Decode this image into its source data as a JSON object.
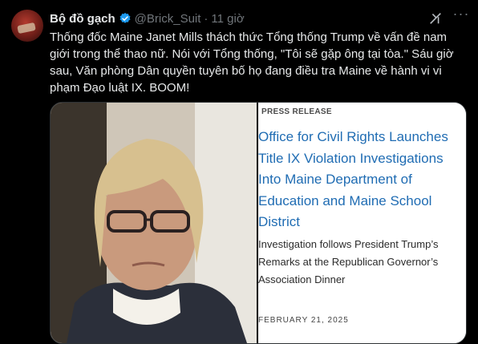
{
  "tweet": {
    "display_name": "Bộ đồ gạch",
    "handle": "@Brick_Suit",
    "separator": "·",
    "time": "11 giờ",
    "verified_icon": "verified-badge-icon",
    "grok_icon": "grok-icon",
    "more_icon": "more-options-icon",
    "more_glyph": "···",
    "text": "Thống đốc Maine Janet Mills thách thức Tổng thống Trump về vấn đề nam giới trong thể thao nữ. Nói với Tổng thống, \"Tôi sẽ gặp ông tại tòa.\" Sáu giờ sau, Văn phòng Dân quyền tuyên bố họ đang điều tra Maine về hành vi vi phạm Đạo luật IX. BOOM!"
  },
  "media": {
    "press_release": {
      "label": "PRESS RELEASE",
      "title": "Office for Civil Rights Launches\nTitle IX Violation Investigations\nInto Maine Department of\nEducation and Maine School\nDistrict",
      "body": "Investigation follows President Trump’s\nRemarks at the Republican Governor’s\nAssociation Dinner",
      "date": "FEBRUARY 21, 2025"
    }
  },
  "colors": {
    "background": "#000000",
    "text": "#e7e9ea",
    "secondary": "#71767b",
    "verified": "#1d9bf0",
    "release_title": "#1f6cb3"
  }
}
